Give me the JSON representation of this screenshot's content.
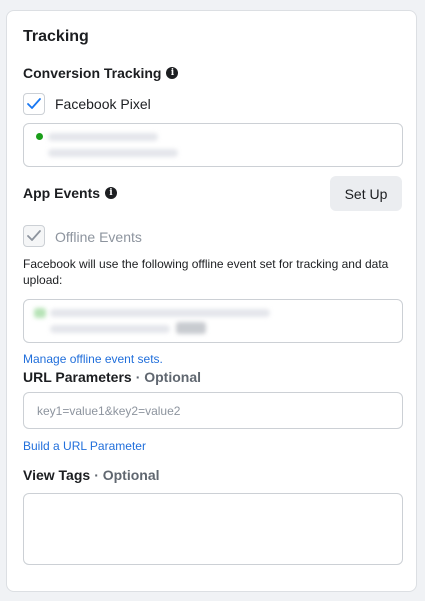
{
  "tracking": {
    "title": "Tracking",
    "conversion_tracking": {
      "label": "Conversion Tracking",
      "pixel": {
        "label": "Facebook Pixel",
        "checked": true,
        "status_color": "#1a9e1a"
      }
    },
    "app_events": {
      "label": "App Events",
      "setup_button": "Set Up",
      "offline_events": {
        "label": "Offline Events",
        "checked": true,
        "disabled": true
      },
      "description": "Facebook will use the following offline event set for tracking and data upload:",
      "manage_link": "Manage offline event sets."
    },
    "url_parameters": {
      "label": "URL Parameters",
      "optional": "· Optional",
      "placeholder": "key1=value1&key2=value2",
      "build_link": "Build a URL Parameter"
    },
    "view_tags": {
      "label": "View Tags",
      "optional": "· Optional",
      "value": ""
    }
  },
  "icons": {
    "info": "info-icon",
    "check": "checkmark-icon"
  },
  "colors": {
    "link": "#216fdb",
    "checkmark": "#1877f2",
    "checkmark_disabled": "#8d949e"
  }
}
